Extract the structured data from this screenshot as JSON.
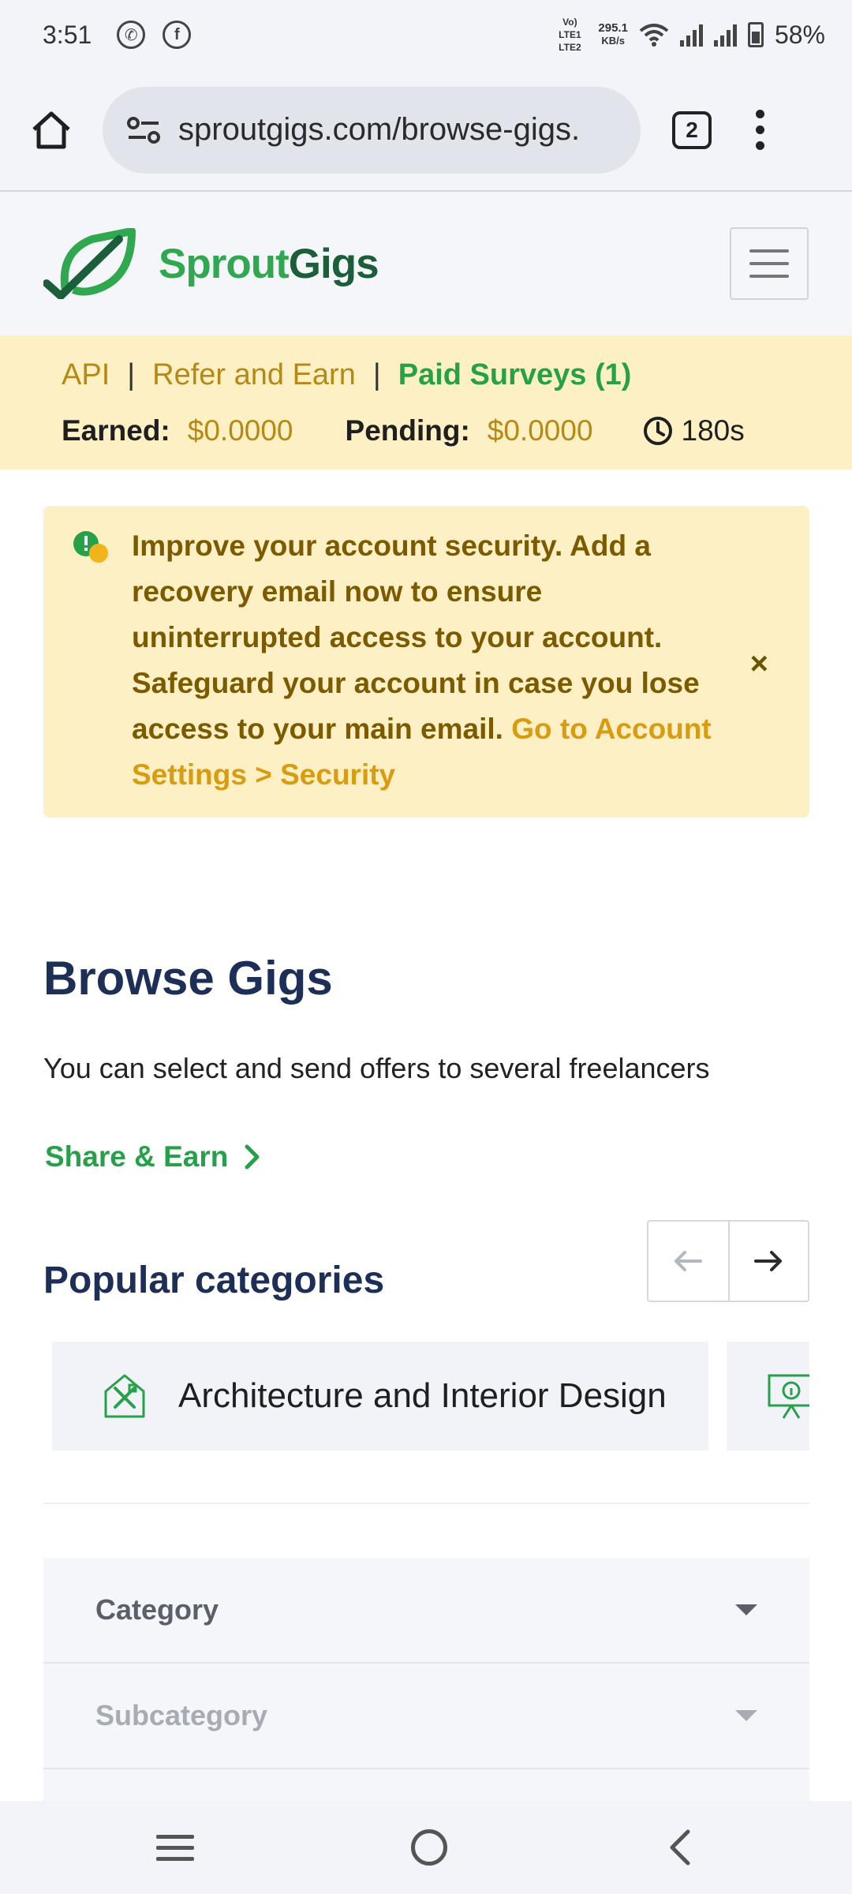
{
  "status_bar": {
    "time": "3:51",
    "app_icons": [
      "whatsapp-icon",
      "facebook-icon"
    ],
    "network_type": "Vo) LTE1 LTE2",
    "speed_value": "295.1",
    "speed_unit": "KB/s",
    "battery": "58%"
  },
  "browser": {
    "url": "sproutgigs.com/browse-gigs.",
    "tab_count": "2"
  },
  "header": {
    "logo_part1": "Sprout",
    "logo_part2": "Gigs"
  },
  "earn_bar": {
    "links": {
      "api": "API",
      "refer": "Refer and Earn",
      "surveys": "Paid Surveys (1)"
    },
    "separator": "|",
    "earned_label": "Earned:",
    "earned_value": "$0.0000",
    "pending_label": "Pending:",
    "pending_value": "$0.0000",
    "timer": "180s"
  },
  "alert": {
    "message": "Improve your account security. Add a recovery email now to ensure uninterrupted access to your account. Safeguard your account in case you lose access to your main email.",
    "link_text": "Go to Account Settings > Security",
    "close_symbol": "×"
  },
  "main": {
    "title": "Browse Gigs",
    "subtitle": "You can select and send offers to several freelancers",
    "share_link": "Share & Earn"
  },
  "categories": {
    "heading": "Popular categories",
    "items": [
      {
        "label": "Architecture and Interior Design",
        "icon": "architecture-icon"
      },
      {
        "label": "",
        "icon": "presentation-icon"
      }
    ]
  },
  "filters": {
    "category": "Category",
    "subcategory": "Subcategory"
  },
  "colors": {
    "brand_green": "#27a04a",
    "brand_dark_green": "#1b5e3a",
    "gold": "#b58913",
    "heading_navy": "#1e2f57",
    "alert_bg": "#fdf0c4"
  }
}
